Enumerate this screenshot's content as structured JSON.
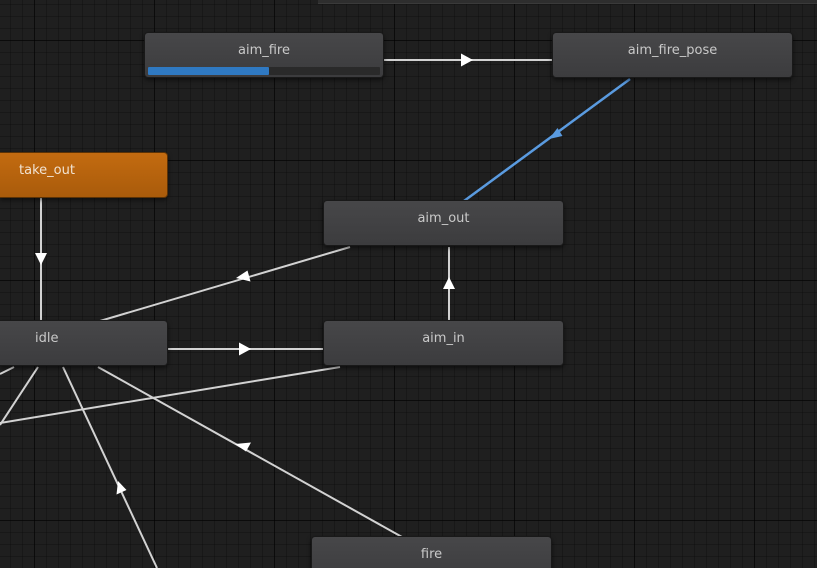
{
  "nodes": {
    "aim_fire": {
      "label": "aim_fire",
      "progress": 0.52
    },
    "aim_fire_pose": {
      "label": "aim_fire_pose"
    },
    "take_out": {
      "label": "take_out"
    },
    "aim_out": {
      "label": "aim_out"
    },
    "idle": {
      "label": "idle"
    },
    "aim_in": {
      "label": "aim_in"
    },
    "fire": {
      "label": "fire"
    }
  },
  "colors": {
    "canvas_background": "#1f1f1f",
    "node_background": "#424244",
    "default_state": "#c36b10",
    "transition": "#d2d2d2",
    "active_transition": "#5a9be0",
    "progress": "#2f79c2"
  }
}
